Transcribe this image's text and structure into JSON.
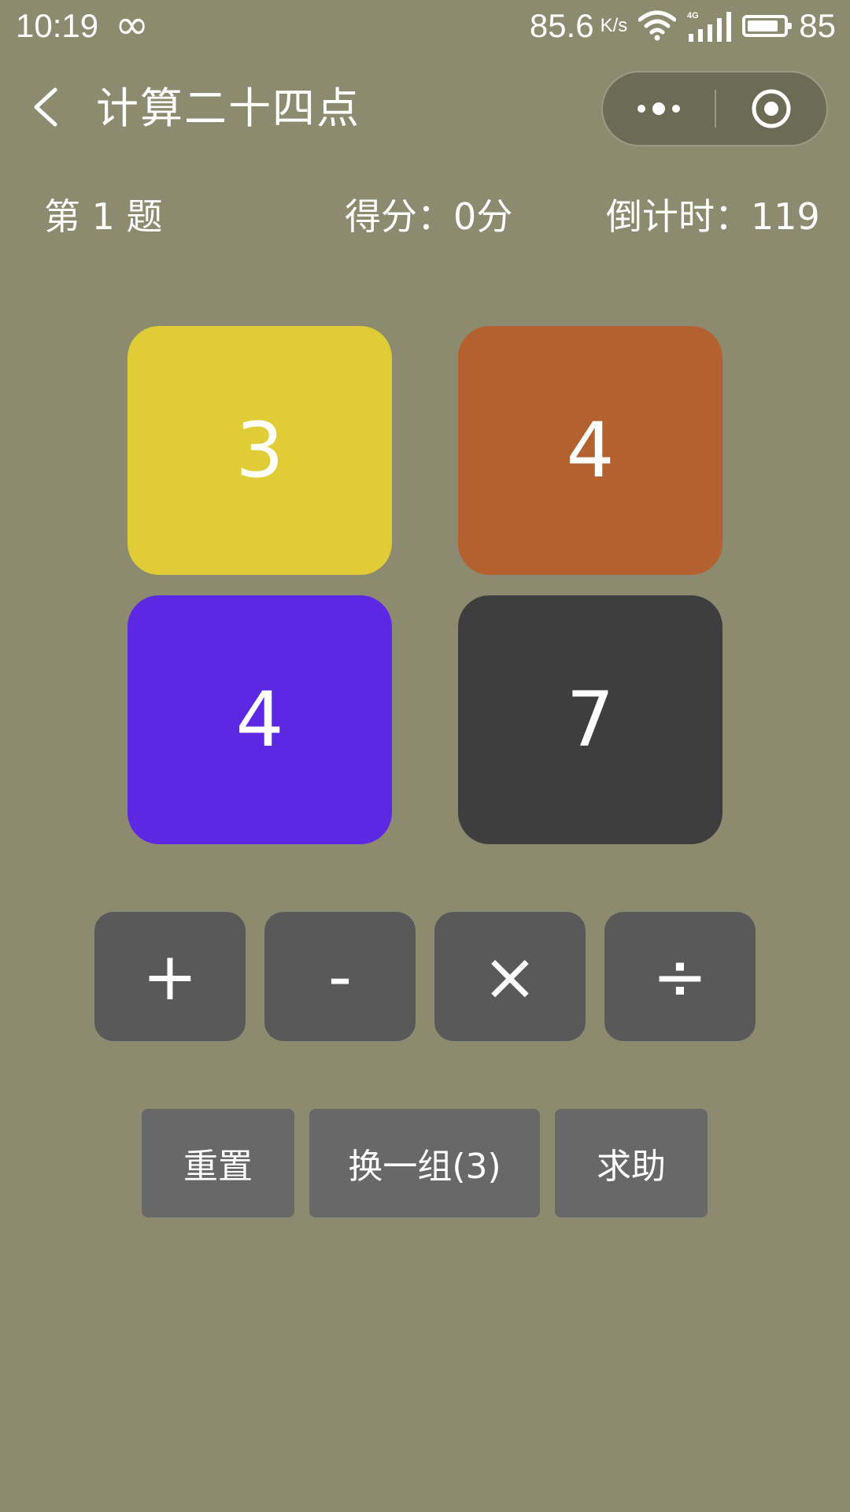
{
  "status_bar": {
    "time": "10:19",
    "infinity_glyph": "∞",
    "speed": "85.6",
    "speed_unit": "K/s",
    "network": "4G",
    "battery_level": "85",
    "battery_fraction": 0.85
  },
  "nav": {
    "title": "计算二十四点",
    "back_icon": "chevron-left-icon",
    "more_icon": "more-dots-icon",
    "close_icon": "target-close-icon"
  },
  "info": {
    "question": "第 1 题",
    "score": "得分：0分",
    "countdown": "倒计时：119"
  },
  "cards": [
    {
      "value": "3",
      "color": "#dfcc36"
    },
    {
      "value": "4",
      "color": "#b3612f"
    },
    {
      "value": "4",
      "color": "#5d28e4"
    },
    {
      "value": "7",
      "color": "#3f3e3f"
    }
  ],
  "operators": {
    "plus": "+",
    "minus": "-",
    "times": "×",
    "divide": "÷"
  },
  "actions": {
    "reset": "重置",
    "change": "换一组(3)",
    "help": "求助"
  },
  "colors": {
    "background": "#8c8a6f",
    "operator_button": "#5a595a",
    "action_button": "#696869",
    "capsule": "#6c6b55"
  }
}
